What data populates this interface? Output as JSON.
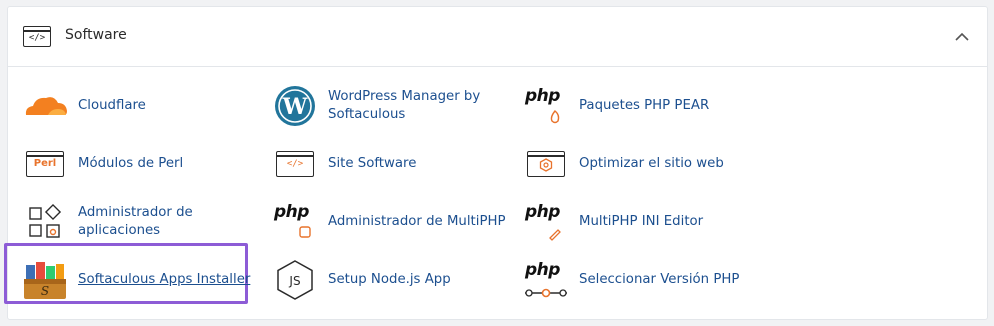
{
  "section": {
    "title": "Software",
    "header_icon_code": "</>"
  },
  "columns": [
    {
      "items": [
        {
          "label": "Cloudflare",
          "icon": "cloudflare-icon"
        },
        {
          "label": "Módulos de Perl",
          "icon": "perl-icon",
          "icon_text": "Perl"
        },
        {
          "label": "Administrador de aplicaciones",
          "icon": "app-manager-icon"
        },
        {
          "label": "Softaculous Apps Installer",
          "icon": "softaculous-icon",
          "selected": true
        }
      ]
    },
    {
      "items": [
        {
          "label": "WordPress Manager by Softaculous",
          "icon": "wordpress-icon"
        },
        {
          "label": "Site Software",
          "icon": "site-software-icon",
          "icon_text": "</>"
        },
        {
          "label": "Administrador de MultiPHP",
          "icon": "php-icon",
          "icon_text": "php"
        },
        {
          "label": "Setup Node.js App",
          "icon": "nodejs-icon",
          "icon_text": "JS"
        }
      ]
    },
    {
      "items": [
        {
          "label": "Paquetes PHP PEAR",
          "icon": "php-pear-icon",
          "icon_text": "php"
        },
        {
          "label": "Optimizar el sitio web",
          "icon": "optimize-icon"
        },
        {
          "label": "MultiPHP INI Editor",
          "icon": "php-ini-icon",
          "icon_text": "php"
        },
        {
          "label": "Seleccionar Versión PHP",
          "icon": "php-version-icon",
          "icon_text": "php"
        }
      ]
    }
  ],
  "colors": {
    "link": "#1c4f8f",
    "accent_orange": "#e8732c",
    "selection": "#8d5cd6"
  }
}
